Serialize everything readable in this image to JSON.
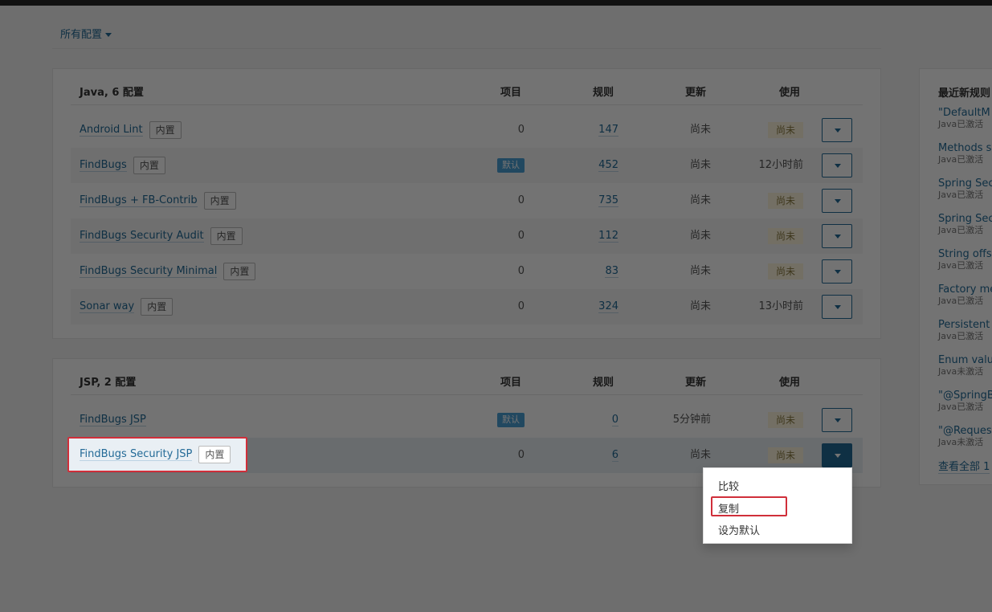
{
  "header": {
    "title": "所有配置"
  },
  "columns": {
    "projects": "项目",
    "rules": "规则",
    "updated": "更新",
    "used": "使用"
  },
  "java": {
    "title": "Java, 6 配置",
    "rows": [
      {
        "name": "Android Lint",
        "badge": "内置",
        "projects": "0",
        "rules": "147",
        "updated": "尚未",
        "used": "尚未"
      },
      {
        "name": "FindBugs",
        "badge": "内置",
        "projects": "默认",
        "rules": "452",
        "updated": "尚未",
        "used": "12小时前"
      },
      {
        "name": "FindBugs + FB-Contrib",
        "badge": "内置",
        "projects": "0",
        "rules": "735",
        "updated": "尚未",
        "used": "尚未"
      },
      {
        "name": "FindBugs Security Audit",
        "badge": "内置",
        "projects": "0",
        "rules": "112",
        "updated": "尚未",
        "used": "尚未"
      },
      {
        "name": "FindBugs Security Minimal",
        "badge": "内置",
        "projects": "0",
        "rules": "83",
        "updated": "尚未",
        "used": "尚未"
      },
      {
        "name": "Sonar way",
        "badge": "内置",
        "projects": "0",
        "rules": "324",
        "updated": "尚未",
        "used": "13小时前"
      }
    ]
  },
  "jsp": {
    "title": "JSP, 2 配置",
    "rows": [
      {
        "name": "FindBugs JSP",
        "badge": "",
        "projects": "默认",
        "rules": "0",
        "updated": "5分钟前",
        "used": "尚未"
      },
      {
        "name": "FindBugs Security JSP",
        "badge": "内置",
        "projects": "0",
        "rules": "6",
        "updated": "尚未",
        "used": "尚未"
      }
    ]
  },
  "dropdown": {
    "items": [
      "比较",
      "复制",
      "设为默认"
    ]
  },
  "sidebar": {
    "title": "最近新规则",
    "items": [
      {
        "title": "\"DefaultM",
        "status": "Java已激活"
      },
      {
        "title": "Methods s",
        "status": "Java已激活"
      },
      {
        "title": "Spring Sec",
        "status": "Java已激活"
      },
      {
        "title": "Spring Sec",
        "status": "Java已激活"
      },
      {
        "title": "String offs",
        "status": "Java已激活"
      },
      {
        "title": "Factory me",
        "status": "Java已激活"
      },
      {
        "title": "Persistent",
        "status": "Java已激活"
      },
      {
        "title": "Enum valu",
        "status": "Java未激活"
      },
      {
        "title": "\"@SpringB",
        "status": "Java已激活"
      },
      {
        "title": "\"@Reques",
        "status": "Java未激活"
      }
    ],
    "more": "查看全部 1"
  }
}
